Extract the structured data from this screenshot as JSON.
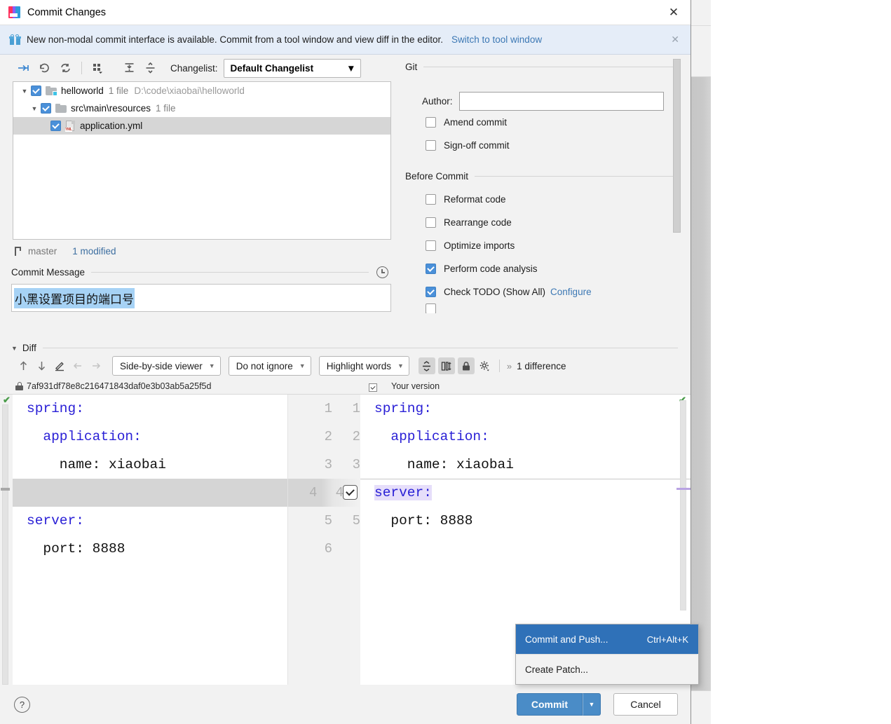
{
  "window": {
    "title": "Commit Changes",
    "app_icon": "intellij-idea-icon",
    "close_label": "✕"
  },
  "banner": {
    "icon": "gift-icon",
    "text": "New non-modal commit interface is available. Commit from a tool window and view diff in the editor.",
    "link": "Switch to tool window",
    "close": "✕",
    "bg_color": "#e5edf8"
  },
  "toolbar": {
    "icons": [
      {
        "name": "move-to-changelist-icon",
        "glyph": "→"
      },
      {
        "name": "revert-icon",
        "glyph": "↺"
      },
      {
        "name": "refresh-icon",
        "glyph": "⟳"
      },
      {
        "name": "group-by-icon",
        "glyph": "⣿"
      },
      {
        "name": "expand-all-icon",
        "glyph": "⤓"
      },
      {
        "name": "collapse-all-icon",
        "glyph": "⤒"
      }
    ],
    "changelist_label": "Changelist:",
    "changelist_value": "Default Changelist"
  },
  "file_tree": [
    {
      "name": "helloworld",
      "meta": "1 file",
      "path": "D:\\code\\xiaobai\\helloworld",
      "checked": true,
      "expanded": true,
      "level": 0,
      "icon": "module-folder-icon",
      "selected": false
    },
    {
      "name": "src\\main\\resources",
      "meta": "1 file",
      "path": "",
      "checked": true,
      "expanded": true,
      "level": 1,
      "icon": "folder-icon",
      "selected": false
    },
    {
      "name": "application.yml",
      "meta": "",
      "path": "",
      "checked": true,
      "expanded": null,
      "level": 2,
      "icon": "yml-file-icon",
      "selected": true
    }
  ],
  "branch_bar": {
    "icon": "git-branch-icon",
    "branch": "master",
    "status": "1 modified"
  },
  "commit_message": {
    "label": "Commit Message",
    "history_icon": "clock-icon",
    "value": "小黑设置项目的端口号",
    "selected": true,
    "selection_color": "#a6d2f5"
  },
  "git_panel": {
    "group_title": "Git",
    "author_label": "Author:",
    "author_value": "",
    "options": [
      {
        "label": "Amend commit",
        "checked": false
      },
      {
        "label": "Sign-off commit",
        "checked": false
      }
    ]
  },
  "before_commit": {
    "group_title": "Before Commit",
    "options": [
      {
        "label": "Reformat code",
        "checked": false,
        "link": ""
      },
      {
        "label": "Rearrange code",
        "checked": false,
        "link": ""
      },
      {
        "label": "Optimize imports",
        "checked": false,
        "link": ""
      },
      {
        "label": "Perform code analysis",
        "checked": true,
        "link": ""
      },
      {
        "label": "Check TODO (Show All)",
        "checked": true,
        "link": "Configure"
      }
    ]
  },
  "diff": {
    "section_title": "Diff",
    "toolbar": {
      "prev_diff_icon": "arrow-up-icon",
      "next_diff_icon": "arrow-down-icon",
      "edit_icon": "pencil-icon",
      "apply_left_icon": "arrow-left-icon",
      "apply_right_icon": "arrow-right-icon",
      "viewer_mode": "Side-by-side viewer",
      "whitespace_mode": "Do not ignore",
      "highlight_mode": "Highlight words",
      "collapse_unchanged_icon": "collapse-unchanged-icon",
      "sync_scroll_icon": "sync-scroll-icon",
      "read_only_icon": "lock-icon",
      "settings_icon": "gear-icon",
      "overflow_icon": "»",
      "difference_count": "1 difference"
    },
    "left_header": {
      "lock_icon": "lock-icon",
      "revision": "7af931df78e8c216471843daf0e3b03ab5a25f5d"
    },
    "right_header": {
      "checkbox_checked": true,
      "title": "Your version"
    },
    "left_lines": [
      {
        "num": "1",
        "text": "spring:",
        "type": "context"
      },
      {
        "num": "2",
        "text": "  application:",
        "type": "context"
      },
      {
        "num": "3",
        "text": "    name: xiaobai",
        "type": "context"
      },
      {
        "num": "4",
        "text": "",
        "type": "gap"
      },
      {
        "num": "5",
        "text": "server:",
        "type": "context"
      },
      {
        "num": "6",
        "text": "  port: 8888",
        "type": "context"
      }
    ],
    "right_lines": [
      {
        "num": "1",
        "text": "spring:",
        "type": "context"
      },
      {
        "num": "2",
        "text": "  application:",
        "type": "context"
      },
      {
        "num": "3",
        "text": "    name: xiaobai",
        "type": "context"
      },
      {
        "num": "4",
        "text": "server:",
        "type": "inserted",
        "accept_checkbox": true
      },
      {
        "num": "5",
        "text": "  port: 8888",
        "type": "inserted"
      }
    ],
    "left_ok_icon": "green-check-icon",
    "right_ok_icon": "green-check-icon"
  },
  "context_menu": {
    "items": [
      {
        "label": "Commit and Push...",
        "shortcut": "Ctrl+Alt+K",
        "active": true
      },
      {
        "label": "Create Patch...",
        "shortcut": "",
        "active": false
      }
    ],
    "highlight_color": "#2f71b8"
  },
  "bottom_bar": {
    "help_icon": "question-mark-icon",
    "commit_label": "Commit",
    "commit_dropdown_icon": "chevron-down-icon",
    "cancel_label": "Cancel",
    "accent_color": "#4a8cc7"
  }
}
